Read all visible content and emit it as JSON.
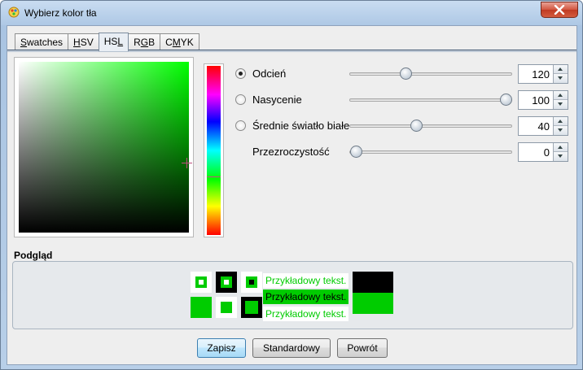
{
  "window": {
    "title": "Wybierz kolor tła"
  },
  "tabs": [
    {
      "label": "Swatches",
      "mnemonic": "S"
    },
    {
      "label": "HSV",
      "mnemonic": "H"
    },
    {
      "label": "HSL",
      "mnemonic": "L",
      "active": true
    },
    {
      "label": "RGB",
      "mnemonic": "G"
    },
    {
      "label": "CMYK",
      "mnemonic": "M"
    }
  ],
  "controls": [
    {
      "label": "Odcień",
      "value": "120",
      "selected": true,
      "slider_fraction": 0.333
    },
    {
      "label": "Nasycenie",
      "value": "100",
      "selected": false,
      "slider_fraction": 1.0
    },
    {
      "label": "Średnie światło białe",
      "value": "40",
      "selected": false,
      "slider_fraction": 0.4
    },
    {
      "label": "Przezroczystość",
      "value": "0",
      "selected": false,
      "slider_fraction": 0.0
    }
  ],
  "preview": {
    "title": "Podgląd",
    "sample_text": "Przykładowy tekst.",
    "color": "#00cc00"
  },
  "buttons": {
    "ok": "Zapisz",
    "reset_defaults": "Standardowy",
    "revert": "Powrót"
  },
  "icons": {
    "title": "palette-icon",
    "close": "close-icon"
  }
}
